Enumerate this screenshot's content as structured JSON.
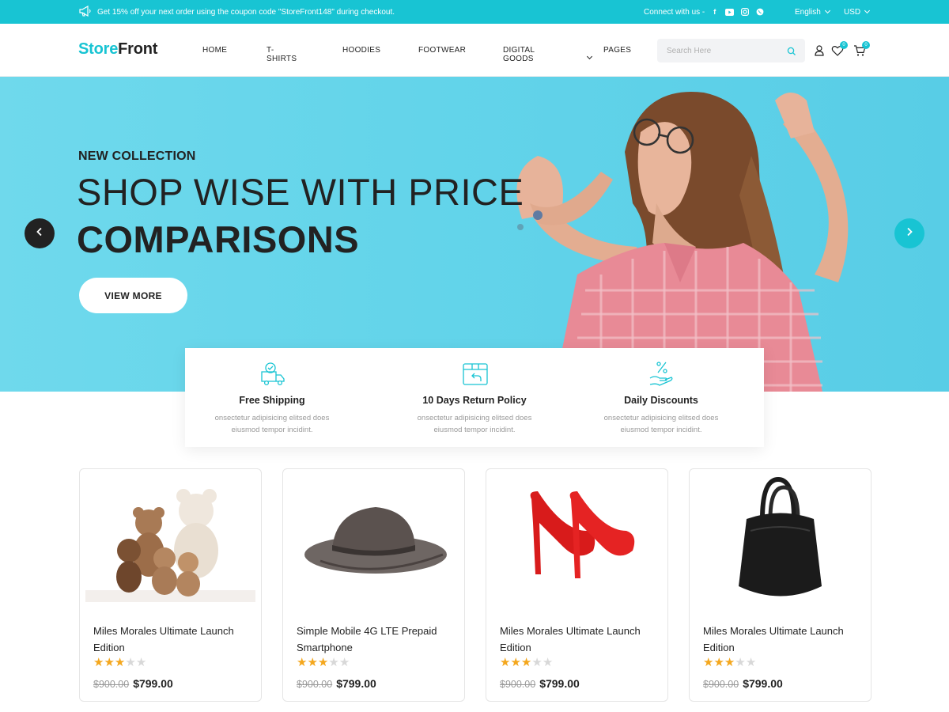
{
  "topbar": {
    "promo_text": "Get 15% off your next order using the coupon code \"StoreFront148\" during checkout.",
    "connect_label": "Connect with us -",
    "social": [
      "facebook-icon",
      "youtube-icon",
      "instagram-icon",
      "whatsapp-icon"
    ],
    "language": "English",
    "currency": "USD"
  },
  "header": {
    "logo_part1": "Store",
    "logo_part2": "Front",
    "nav": [
      "HOME",
      "T-SHIRTS",
      "HOODIES",
      "FOOTWEAR",
      "DIGITAL GOODS",
      "PAGES"
    ],
    "search_placeholder": "Search Here",
    "wishlist_count": "0",
    "cart_count": "0"
  },
  "hero": {
    "subtitle": "NEW COLLECTION",
    "title_line1": "SHOP WISE WITH PRICE",
    "title_line2": "COMPARISONS",
    "button_label": "VIEW MORE"
  },
  "features": [
    {
      "title": "Free Shipping",
      "description": "onsectetur adipisicing elitsed does eiusmod tempor incidint.",
      "icon": "truck-icon"
    },
    {
      "title": "10 Days Return Policy",
      "description": "onsectetur adipisicing elitsed does eiusmod tempor incidint.",
      "icon": "return-box-icon"
    },
    {
      "title": "Daily Discounts",
      "description": "onsectetur adipisicing elitsed does eiusmod tempor incidint.",
      "icon": "discount-hand-icon"
    }
  ],
  "products": [
    {
      "title": "Miles Morales Ultimate Launch Edition",
      "rating": 3,
      "max_rating": 5,
      "old_price": "$900.00",
      "price": "$799.00",
      "image": "teddy-bears"
    },
    {
      "title": "Simple Mobile 4G LTE Prepaid Smartphone",
      "rating": 3,
      "max_rating": 5,
      "old_price": "$900.00",
      "price": "$799.00",
      "image": "leather-hat"
    },
    {
      "title": "Miles Morales Ultimate Launch Edition",
      "rating": 3,
      "max_rating": 5,
      "old_price": "$900.00",
      "price": "$799.00",
      "image": "red-heels"
    },
    {
      "title": "Miles Morales Ultimate Launch Edition",
      "rating": 3,
      "max_rating": 5,
      "old_price": "$900.00",
      "price": "$799.00",
      "image": "black-handbag"
    }
  ],
  "colors": {
    "accent": "#18c4d3",
    "hero_bg": "#63d4ea",
    "star": "#f4a71d",
    "text": "#222222"
  }
}
